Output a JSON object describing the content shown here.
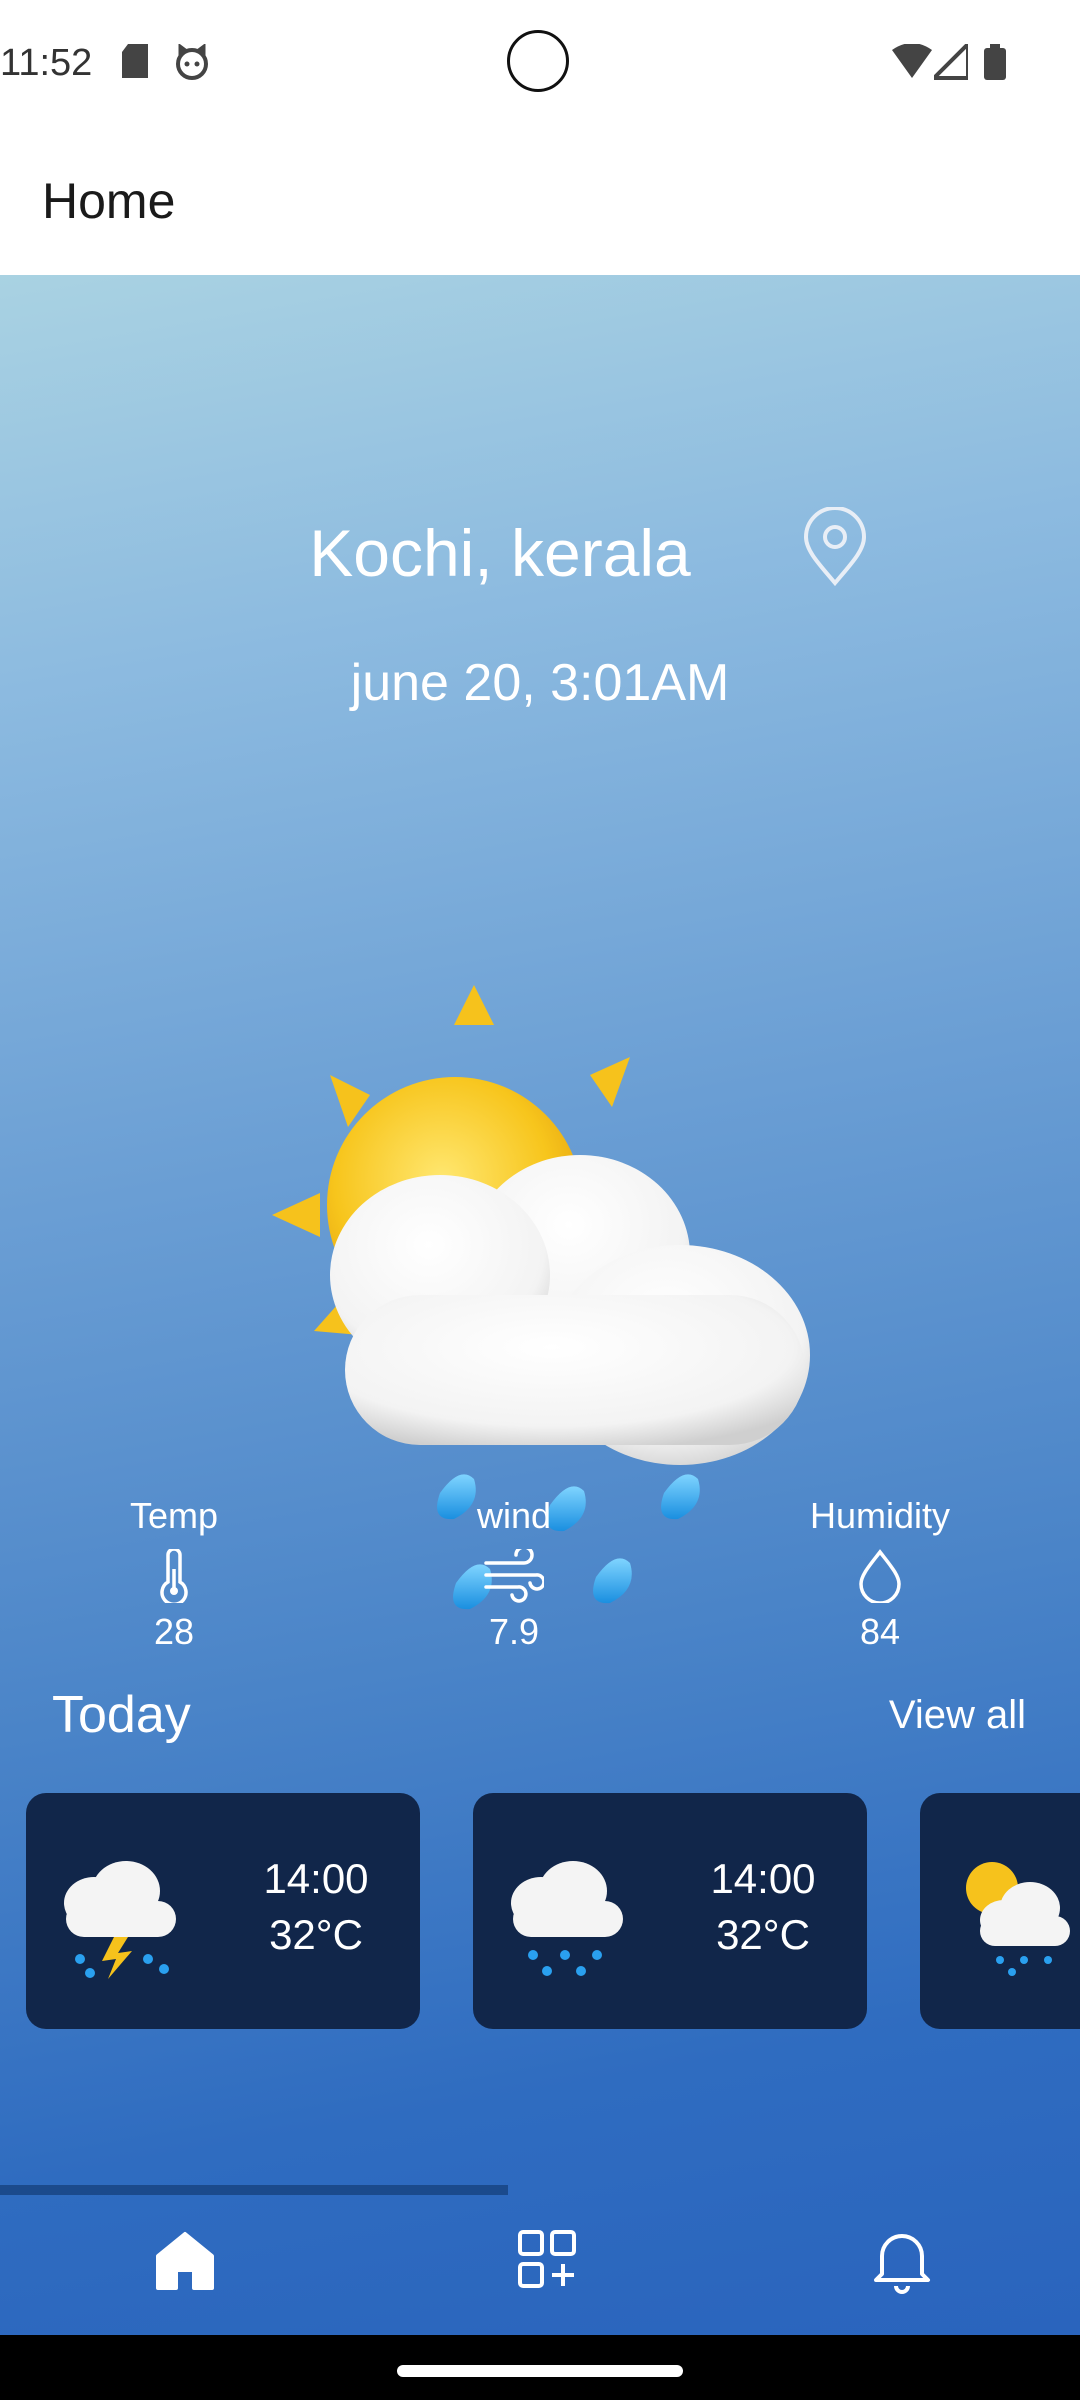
{
  "status_bar": {
    "time": "11:52"
  },
  "app_bar": {
    "title": "Home"
  },
  "location": "Kochi, kerala",
  "datetime": "june 20, 3:01AM",
  "stats": [
    {
      "label": "Temp",
      "value": "28",
      "icon": "thermometer-icon"
    },
    {
      "label": "wind",
      "value": "7.9",
      "icon": "wind-icon"
    },
    {
      "label": "Humidity",
      "value": "84",
      "icon": "droplet-icon"
    }
  ],
  "today": {
    "title": "Today",
    "view_all": "View all"
  },
  "forecast": [
    {
      "time": "14:00",
      "temp": "32°C",
      "icon": "thunderstorm-icon"
    },
    {
      "time": "14:00",
      "temp": "32°C",
      "icon": "rain-cloud-icon"
    },
    {
      "time": "",
      "temp": "",
      "icon": "sun-rain-cloud-icon"
    }
  ],
  "scroll_progress_fraction": 0.47,
  "nav": [
    {
      "name": "home",
      "icon": "home-icon",
      "active": true
    },
    {
      "name": "add-widget",
      "icon": "add-widget-icon",
      "active": false
    },
    {
      "name": "notifications",
      "icon": "bell-icon",
      "active": false
    }
  ],
  "colors": {
    "card_bg": "#11264a",
    "nav_active": "#ffffff",
    "nav_inactive": "#ffffff"
  }
}
